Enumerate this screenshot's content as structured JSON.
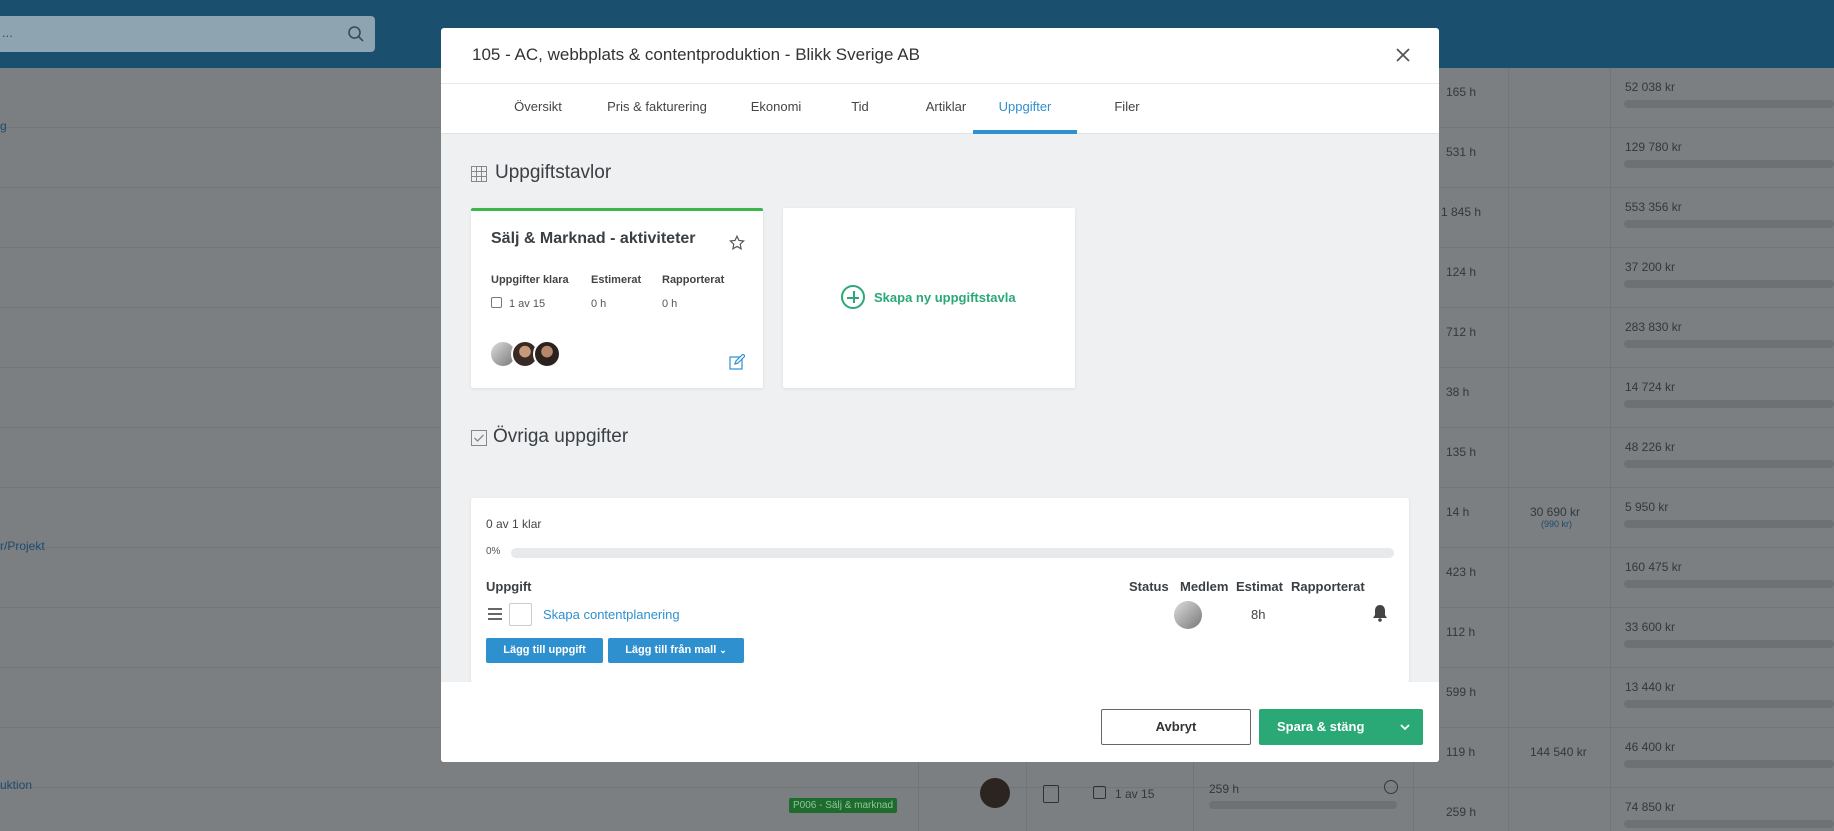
{
  "background": {
    "search_text": "...",
    "links": [
      "g",
      "r/Projekt",
      "uktion"
    ],
    "rows": [
      {
        "hours": "165 h",
        "extra": "",
        "sub": "",
        "amount": "52 038 kr"
      },
      {
        "hours": "531 h",
        "extra": "",
        "sub": "",
        "amount": "129 780 kr"
      },
      {
        "hours": "1 845 h",
        "extra": "",
        "sub": "",
        "amount": "553 356 kr"
      },
      {
        "hours": "124 h",
        "extra": "",
        "sub": "",
        "amount": "37 200 kr"
      },
      {
        "hours": "712 h",
        "extra": "",
        "sub": "",
        "amount": "283 830 kr"
      },
      {
        "hours": "38 h",
        "extra": "",
        "sub": "",
        "amount": "14 724 kr"
      },
      {
        "hours": "135 h",
        "extra": "",
        "sub": "",
        "amount": "48 226 kr"
      },
      {
        "hours": "14 h",
        "extra": "30 690 kr",
        "sub": "(990 kr)",
        "amount": "5 950 kr"
      },
      {
        "hours": "423 h",
        "extra": "",
        "sub": "",
        "amount": "160 475 kr"
      },
      {
        "hours": "112 h",
        "extra": "",
        "sub": "",
        "amount": "33 600 kr"
      },
      {
        "hours": "599 h",
        "extra": "",
        "sub": "",
        "amount": "13 440 kr"
      },
      {
        "hours": "119 h",
        "extra": "144 540 kr",
        "sub": "",
        "amount": "46 400 kr"
      },
      {
        "hours": "259 h",
        "extra": "",
        "sub": "",
        "amount": "74 850 kr"
      }
    ],
    "last_row": {
      "tag": "P006 - Sälj & marknad",
      "tasks": "1 av 15",
      "hours_reported": "259 h"
    }
  },
  "modal": {
    "title": "105 - AC, webbplats & contentproduktion - Blikk Sverige AB",
    "tabs": [
      "Översikt",
      "Pris & fakturering",
      "Ekonomi",
      "Tid",
      "Artiklar",
      "Uppgifter",
      "Filer"
    ],
    "active_tab": "Uppgifter",
    "boards_section": {
      "title": "Uppgiftstavlor",
      "board": {
        "name": "Sälj & Marknad - aktiviteter",
        "tasks_done_label": "Uppgifter klara",
        "tasks_done_value": "1 av 15",
        "estimated_label": "Estimerat",
        "estimated_value": "0 h",
        "reported_label": "Rapporterat",
        "reported_value": "0 h"
      },
      "new_board_label": "Skapa ny uppgiftstavla"
    },
    "other_tasks": {
      "title": "Övriga uppgifter",
      "done_text": "0 av 1 klar",
      "percent_label": "0%",
      "progress": 0,
      "headers": {
        "task": "Uppgift",
        "status": "Status",
        "member": "Medlem",
        "estimate": "Estimat",
        "reported": "Rapporterat"
      },
      "tasks": [
        {
          "name": "Skapa contentplanering",
          "estimate": "8h"
        }
      ],
      "add_task_label": "Lägg till uppgift",
      "add_from_template_label": "Lägg till från mall"
    },
    "footer": {
      "cancel_label": "Avbryt",
      "save_label": "Spara & stäng"
    }
  },
  "colors": {
    "accent": "#2f90cf",
    "green": "#2aa876",
    "board_top": "#3cb54a",
    "topbar": "#1b4f6e"
  }
}
